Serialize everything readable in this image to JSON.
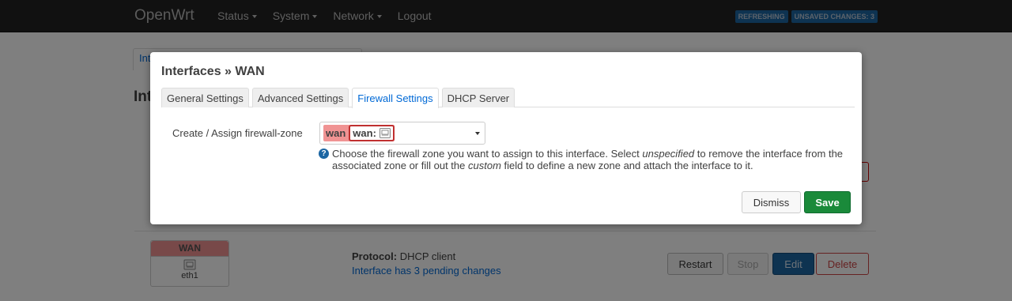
{
  "header": {
    "brand": "OpenWrt",
    "nav": [
      {
        "label": "Status"
      },
      {
        "label": "System"
      },
      {
        "label": "Network"
      },
      {
        "label": "Logout"
      }
    ],
    "indicators": {
      "refreshing": "REFRESHING",
      "unsaved": "UNSAVED CHANGES: 3"
    }
  },
  "background": {
    "tab_partial": "Int",
    "heading_partial": "Int",
    "interface": {
      "name": "WAN",
      "device": "eth1",
      "protocol_label": "Protocol:",
      "protocol_value": "DHCP client",
      "pending": "Interface has 3 pending changes"
    },
    "buttons": {
      "restart": "Restart",
      "stop": "Stop",
      "edit": "Edit",
      "delete": "Delete"
    }
  },
  "modal": {
    "title": "Interfaces » WAN",
    "tabs": [
      {
        "label": "General Settings",
        "active": false
      },
      {
        "label": "Advanced Settings",
        "active": false
      },
      {
        "label": "Firewall Settings",
        "active": true
      },
      {
        "label": "DHCP Server",
        "active": false
      }
    ],
    "firewall": {
      "label": "Create / Assign firewall-zone",
      "zone_name": "wan",
      "zone_member": "wan:",
      "help": {
        "part1": "Choose the firewall zone you want to assign to this interface. Select ",
        "em1": "unspecified",
        "part2": " to remove the interface from the associated zone or fill out the ",
        "em2": "custom",
        "part3": " field to define a new zone and attach the interface to it."
      }
    },
    "buttons": {
      "dismiss": "Dismiss",
      "save": "Save"
    }
  },
  "colors": {
    "zone_wan": "#f09393",
    "primary": "#1c66a3",
    "save": "#1a8a3a",
    "link": "#0069d6"
  }
}
